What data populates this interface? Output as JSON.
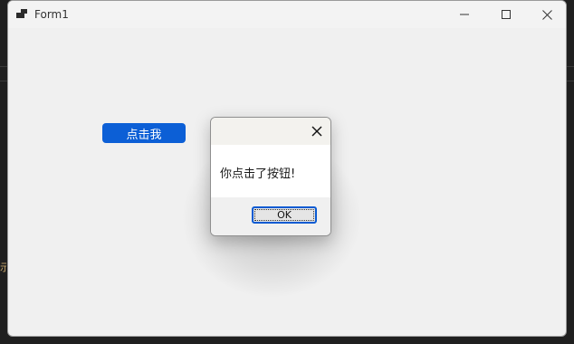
{
  "window": {
    "title": "Form1",
    "minimize_icon": "minimize-icon",
    "maximize_icon": "maximize-icon",
    "close_icon": "close-icon"
  },
  "form": {
    "button_label": "点击我"
  },
  "message_box": {
    "message": "你点击了按钮!",
    "ok_label": "OK",
    "close_icon": "close-icon"
  },
  "colors": {
    "button_blue": "#0c5fd6",
    "window_bg": "#f0f0f0",
    "focus_border": "#0b5bd2"
  }
}
